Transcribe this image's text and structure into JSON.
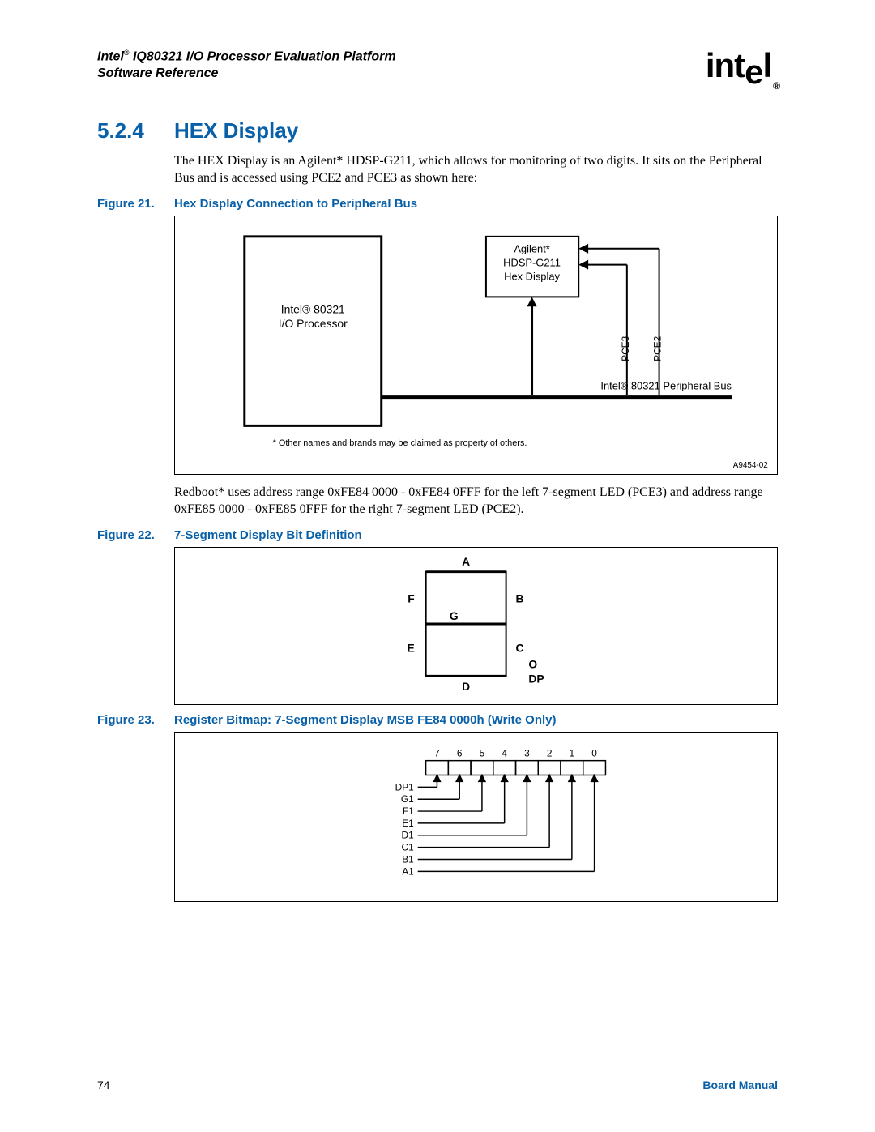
{
  "header": {
    "line1_prefix": "Intel",
    "line1_suffix": " IQ80321 I/O Processor Evaluation Platform",
    "line2": "Software Reference",
    "logo_text": "intel"
  },
  "section": {
    "number": "5.2.4",
    "title": "HEX Display"
  },
  "para1": "The HEX Display is an Agilent* HDSP-G211, which allows for monitoring of two digits. It sits on the Peripheral Bus and is accessed using PCE2 and PCE3 as shown here:",
  "fig21": {
    "label": "Figure 21.",
    "caption": "Hex Display Connection to Peripheral Bus",
    "box_processor_l1": "Intel® 80321",
    "box_processor_l2": "I/O Processor",
    "box_display_l1": "Agilent*",
    "box_display_l2": "HDSP-G211",
    "box_display_l3": "Hex Display",
    "pce3": "PCE3",
    "pce2": "PCE2",
    "bus": "Intel® 80321 Peripheral Bus",
    "footnote": "* Other names and brands may be claimed as property of others.",
    "id": "A9454-02"
  },
  "para2": "Redboot* uses address range 0xFE84 0000 - 0xFE84 0FFF for the left 7-segment LED (PCE3) and address range 0xFE85 0000 - 0xFE85 0FFF for the right 7-segment LED (PCE2).",
  "fig22": {
    "label": "Figure 22.",
    "caption": "7-Segment Display Bit Definition",
    "A": "A",
    "B": "B",
    "C": "C",
    "D": "D",
    "E": "E",
    "F": "F",
    "G": "G",
    "DP_O": "O",
    "DP": "DP"
  },
  "fig23": {
    "label": "Figure 23.",
    "caption": "Register Bitmap: 7-Segment Display MSB FE84 0000h (Write Only)",
    "bits": [
      "7",
      "6",
      "5",
      "4",
      "3",
      "2",
      "1",
      "0"
    ],
    "labels": [
      "DP1",
      "G1",
      "F1",
      "E1",
      "D1",
      "C1",
      "B1",
      "A1"
    ]
  },
  "footer": {
    "page": "74",
    "manual": "Board Manual"
  }
}
